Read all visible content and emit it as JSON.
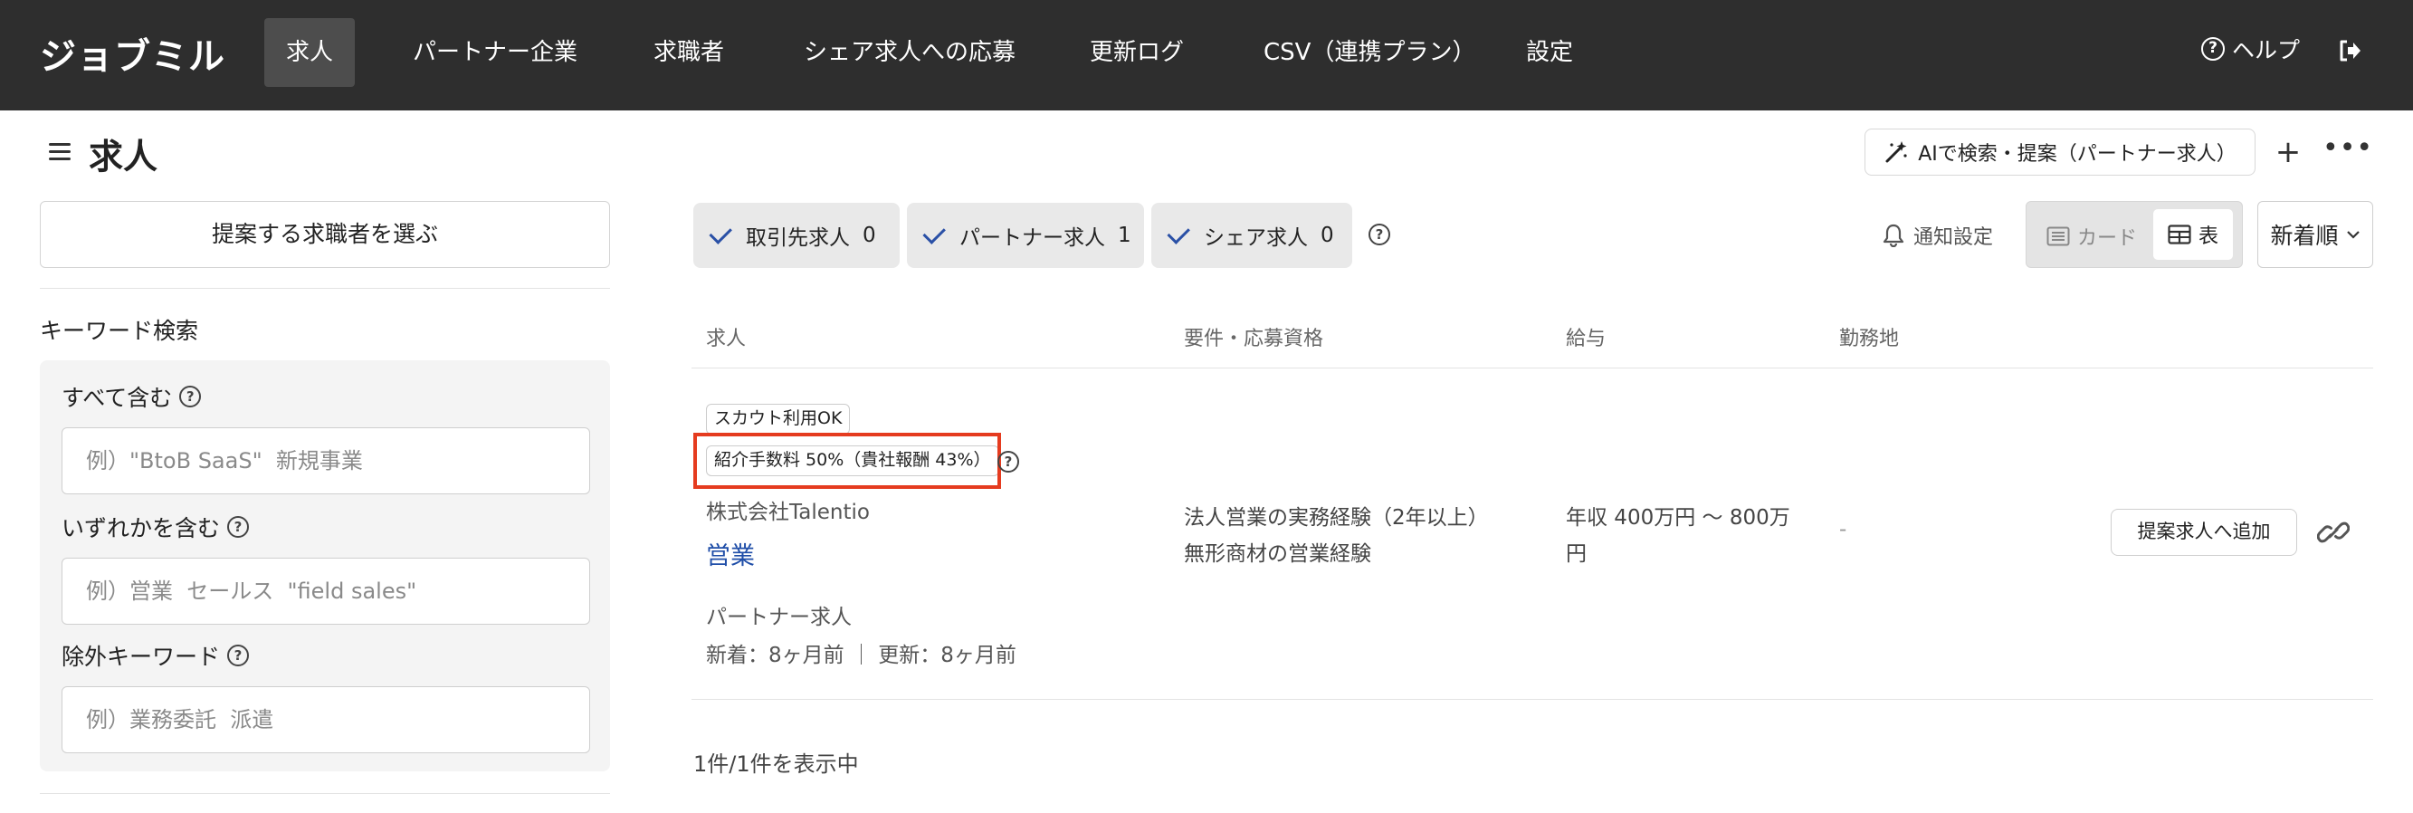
{
  "app": {
    "logo": "ジョブミル",
    "nav": [
      "求人",
      "パートナー企業",
      "求職者",
      "シェア求人への応募",
      "更新ログ",
      "CSV（連携プラン）",
      "設定"
    ],
    "help_label": "ヘルプ"
  },
  "page": {
    "title": "求人",
    "ai_button": "AIで検索・提案（パートナー求人）",
    "plus_label": "+",
    "more_label": "•••"
  },
  "sidebar": {
    "propose_button": "提案する求職者を選ぶ",
    "keyword_title": "キーワード検索",
    "fields": [
      {
        "label": "すべて含む",
        "placeholder": "例）\"BtoB SaaS\"  新規事業"
      },
      {
        "label": "いずれかを含む",
        "placeholder": "例）営業  セールス  \"field sales\""
      },
      {
        "label": "除外キーワード",
        "placeholder": "例）業務委託  派遣"
      }
    ]
  },
  "filters": {
    "chips": [
      {
        "label": "取引先求人",
        "count": "0"
      },
      {
        "label": "パートナー求人",
        "count": "1"
      },
      {
        "label": "シェア求人",
        "count": "0"
      }
    ],
    "notify": "通知設定",
    "view_card": "カード",
    "view_table": "表",
    "sort": "新着順"
  },
  "table": {
    "headers": [
      "求人",
      "要件・応募資格",
      "給与",
      "勤務地"
    ],
    "row": {
      "badge1": "スカウト利用OK",
      "badge2": "紹介手数料 50%（貴社報酬 43%）",
      "company": "株式会社Talentio",
      "job_title": "営業",
      "job_type": "パートナー求人",
      "dates": "新着：8ヶ月前 ｜ 更新：8ヶ月前",
      "req1": "法人営業の実務経験（2年以上）",
      "req2": "無形商材の営業経験",
      "salary": "年収 400万円 〜 800万円",
      "location": "-",
      "add_button": "提案求人へ追加"
    }
  },
  "footer": {
    "count": "1件/1件を表示中"
  },
  "colors": {
    "nav_bg": "#2e2e2e",
    "link": "#1f4ea8",
    "highlight": "#e53b1f",
    "check": "#2a50a6"
  }
}
